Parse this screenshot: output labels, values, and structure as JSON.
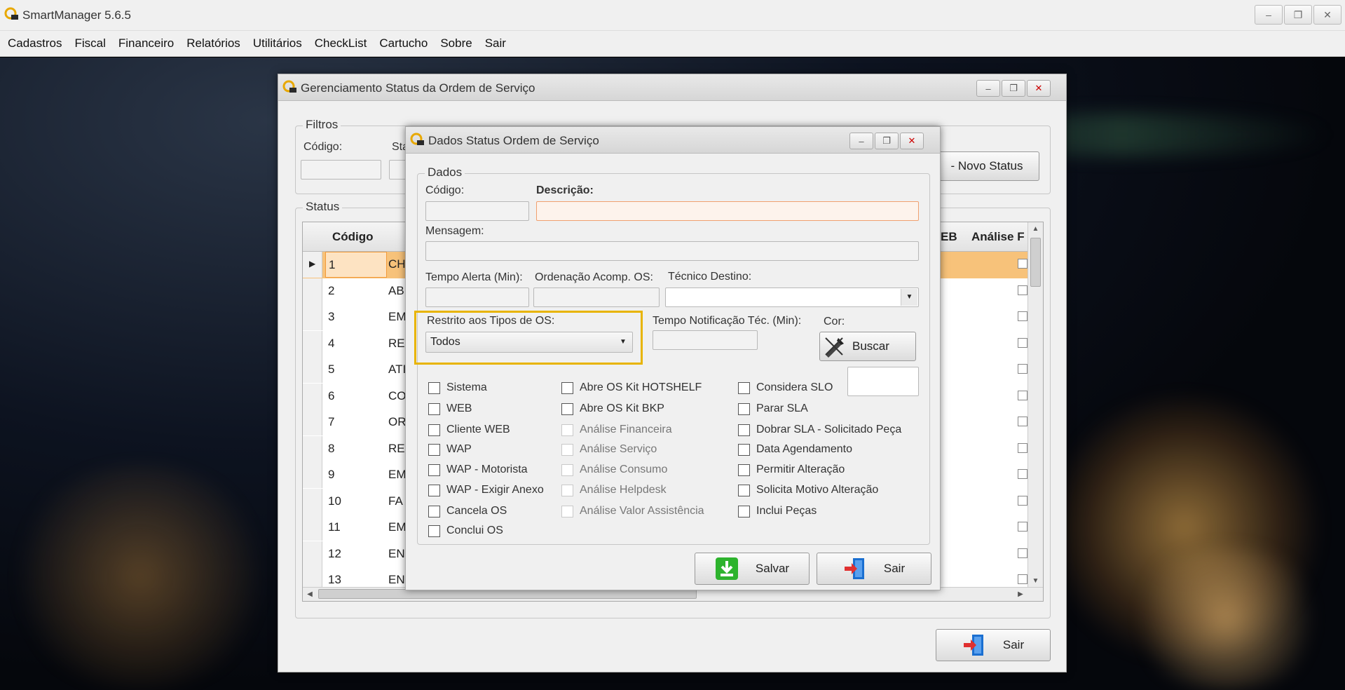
{
  "app": {
    "title": "SmartManager 5.6.5"
  },
  "menu": [
    "Cadastros",
    "Fiscal",
    "Financeiro",
    "Relatórios",
    "Utilitários",
    "CheckList",
    "Cartucho",
    "Sobre",
    "Sair"
  ],
  "window_ctl": {
    "min": "–",
    "max": "❐",
    "close": "✕"
  },
  "status_window": {
    "title": "Gerenciamento Status da Ordem de Serviço",
    "filters": {
      "legend": "Filtros",
      "codigo_label": "Código:",
      "status_label": "Sta",
      "novo_status_button": "- Novo Status"
    },
    "status_group": {
      "legend": "Status"
    },
    "grid": {
      "headers": {
        "codigo": "Código",
        "web": "EB",
        "analise": "Análise F"
      },
      "rows": [
        {
          "codigo": "1",
          "desc": "CH"
        },
        {
          "codigo": "2",
          "desc": "AB"
        },
        {
          "codigo": "3",
          "desc": "EM"
        },
        {
          "codigo": "4",
          "desc": "RE"
        },
        {
          "codigo": "5",
          "desc": "ATI"
        },
        {
          "codigo": "6",
          "desc": "CO"
        },
        {
          "codigo": "7",
          "desc": "OR"
        },
        {
          "codigo": "8",
          "desc": "RE"
        },
        {
          "codigo": "9",
          "desc": "EM"
        },
        {
          "codigo": "10",
          "desc": "FA"
        },
        {
          "codigo": "11",
          "desc": "EM"
        },
        {
          "codigo": "12",
          "desc": "EN"
        },
        {
          "codigo": "13",
          "desc": "EN"
        }
      ]
    },
    "sair_button": "Sair"
  },
  "dados_window": {
    "title": "Dados Status Ordem de Serviço",
    "group_legend": "Dados",
    "codigo_label": "Código:",
    "codigo_value": "",
    "descricao_label": "Descrição:",
    "descricao_value": "",
    "mensagem_label": "Mensagem:",
    "mensagem_value": "",
    "tempo_alerta_label": "Tempo Alerta (Min):",
    "ordenacao_label": "Ordenação Acomp. OS:",
    "tecnico_label": "Técnico Destino:",
    "tecnico_value": "",
    "restrito_label": "Restrito aos Tipos de OS:",
    "restrito_value": "Todos",
    "tempo_notif_label": "Tempo Notificação Téc. (Min):",
    "cor_label": "Cor:",
    "buscar_button": "Buscar",
    "col1": [
      "Sistema",
      "WEB",
      "Cliente WEB",
      "WAP",
      "WAP - Motorista",
      "WAP - Exigir Anexo",
      "Cancela OS",
      "Conclui OS"
    ],
    "col2": [
      "Abre OS Kit HOTSHELF",
      "Abre OS Kit BKP",
      "Análise Financeira",
      "Análise Serviço",
      "Análise Consumo",
      "Análise Helpdesk",
      "Análise Valor Assistência"
    ],
    "col3": [
      "Considera SLO",
      "Parar SLA",
      "Dobrar SLA - Solicitado Peça",
      "Data Agendamento",
      "Permitir Alteração",
      "Solicita Motivo Alteração",
      "Inclui Peças"
    ],
    "salvar_button": "Salvar",
    "sair_button": "Sair"
  },
  "colors": {
    "highlight": "#e8b400",
    "selected_row": "#f7c27a",
    "descricao_border": "#f0a070",
    "salvar_icon": "#2db32d",
    "sair_icon": "#1a6fd1"
  }
}
